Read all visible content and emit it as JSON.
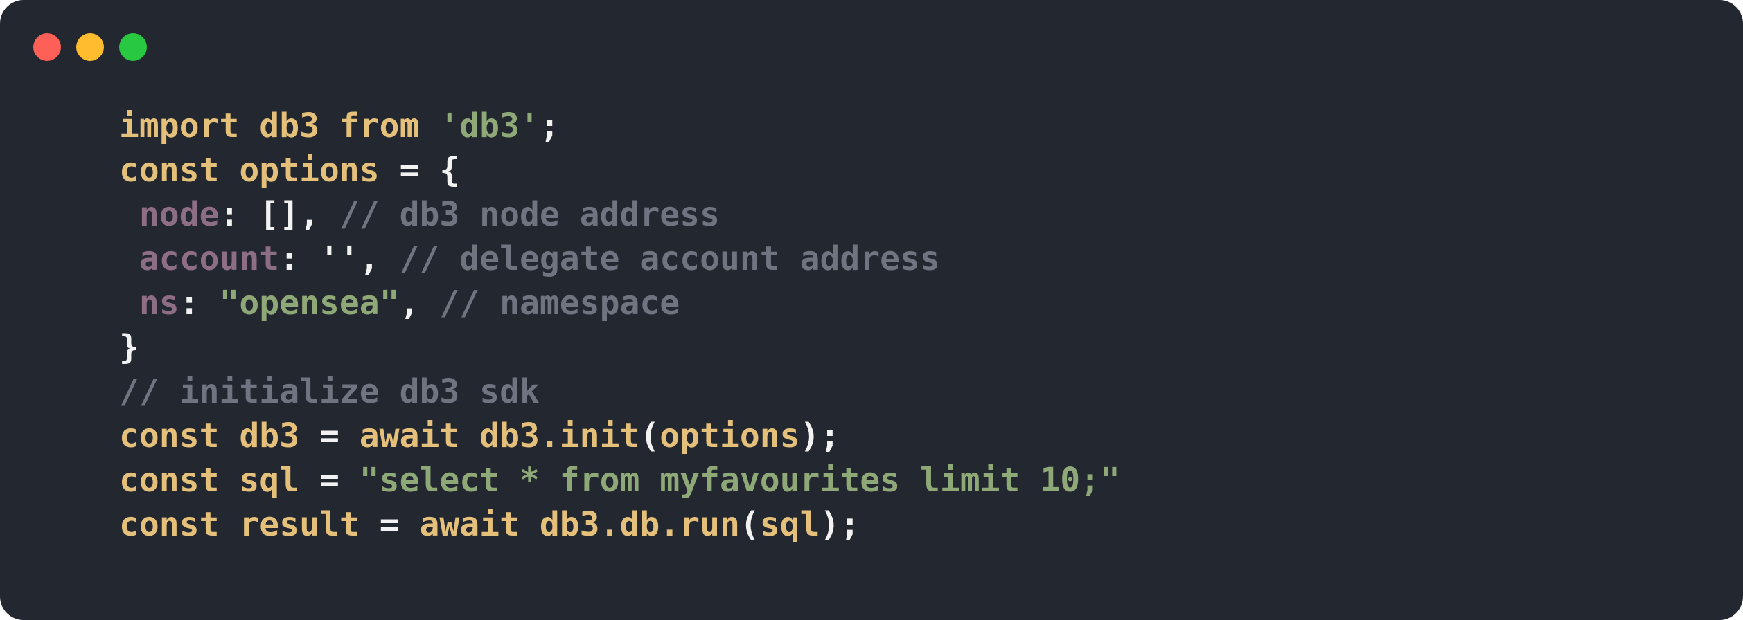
{
  "window": {
    "controls": [
      {
        "name": "close",
        "color": "#fe5f57"
      },
      {
        "name": "minimize",
        "color": "#febc2e"
      },
      {
        "name": "zoom",
        "color": "#28c840"
      }
    ]
  },
  "colors": {
    "background": "#232730",
    "keyword": "#e5c07b",
    "string": "#8fa877",
    "comment": "#6f7480",
    "property": "#8e6e85",
    "punctuation": "#f2f2f2"
  },
  "code": {
    "lines": [
      [
        {
          "t": "import db3 from ",
          "c": "kw"
        },
        {
          "t": "'db3'",
          "c": "str"
        },
        {
          "t": ";",
          "c": "pun"
        }
      ],
      [
        {
          "t": "const options ",
          "c": "kw"
        },
        {
          "t": "= {",
          "c": "pun"
        }
      ],
      [
        {
          "t": " ",
          "c": "pun"
        },
        {
          "t": "node",
          "c": "key"
        },
        {
          "t": ": [], ",
          "c": "pun"
        },
        {
          "t": "// db3 node address",
          "c": "cm"
        }
      ],
      [
        {
          "t": " ",
          "c": "pun"
        },
        {
          "t": "account",
          "c": "key"
        },
        {
          "t": ": '', ",
          "c": "pun"
        },
        {
          "t": "// delegate account address",
          "c": "cm"
        }
      ],
      [
        {
          "t": " ",
          "c": "pun"
        },
        {
          "t": "ns",
          "c": "key"
        },
        {
          "t": ": ",
          "c": "pun"
        },
        {
          "t": "\"opensea\"",
          "c": "str"
        },
        {
          "t": ", ",
          "c": "pun"
        },
        {
          "t": "// namespace",
          "c": "cm"
        }
      ],
      [
        {
          "t": "}",
          "c": "pun"
        }
      ],
      [
        {
          "t": "// initialize db3 sdk",
          "c": "cm"
        }
      ],
      [
        {
          "t": "const db3 ",
          "c": "kw"
        },
        {
          "t": "= ",
          "c": "pun"
        },
        {
          "t": "await db3.init",
          "c": "kw"
        },
        {
          "t": "(",
          "c": "pun"
        },
        {
          "t": "options",
          "c": "kw"
        },
        {
          "t": ");",
          "c": "pun"
        }
      ],
      [
        {
          "t": "const sql ",
          "c": "kw"
        },
        {
          "t": "= ",
          "c": "pun"
        },
        {
          "t": "\"select * from myfavourites limit 10;\"",
          "c": "str"
        }
      ],
      [
        {
          "t": "const result ",
          "c": "kw"
        },
        {
          "t": "= ",
          "c": "pun"
        },
        {
          "t": "await db3.db.run",
          "c": "kw"
        },
        {
          "t": "(",
          "c": "pun"
        },
        {
          "t": "sql",
          "c": "kw"
        },
        {
          "t": ");",
          "c": "pun"
        }
      ]
    ]
  }
}
